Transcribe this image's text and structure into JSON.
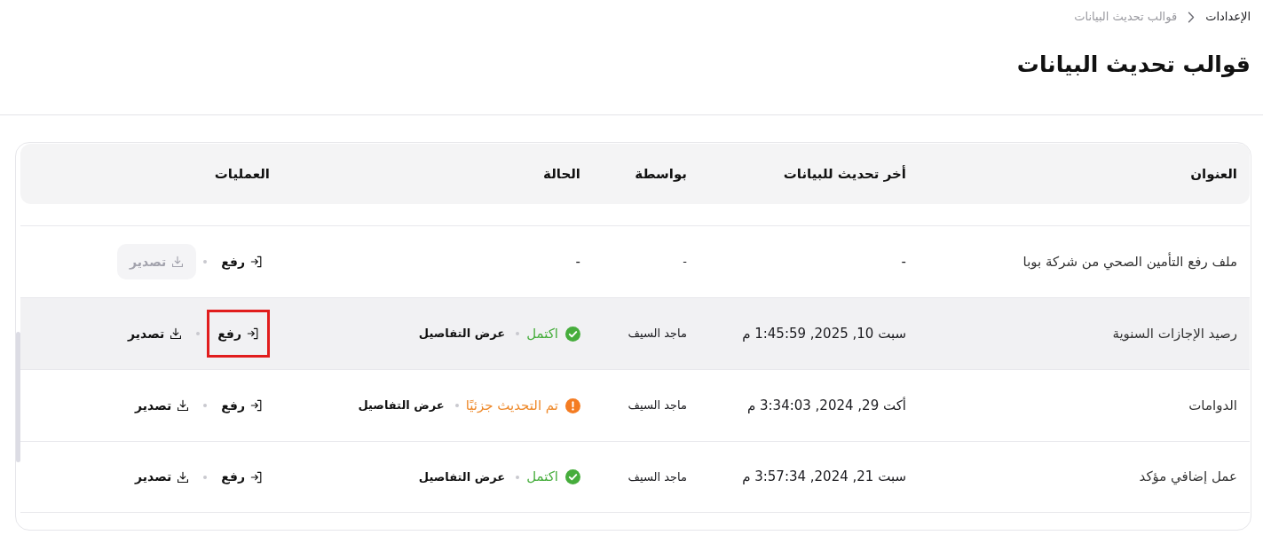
{
  "breadcrumb": [
    {
      "label": "الإعدادات",
      "current": false
    },
    {
      "label": "قوالب تحديث البيانات",
      "current": true
    }
  ],
  "page_title": "قوالب تحديث البيانات",
  "table": {
    "columns": [
      "العنوان",
      "أخر تحديث للبيانات",
      "بواسطة",
      "الحالة",
      "العمليات"
    ],
    "rows": [
      {
        "title": "ملف رفع التأمين الصحي من شركة بوبا",
        "last_update": "-",
        "by": "-",
        "hovered": false,
        "status": {
          "kind": "none",
          "label": "-"
        },
        "actions": [
          {
            "kind": "upload",
            "label": "رفع",
            "disabled": false,
            "highlighted": false
          },
          {
            "kind": "export",
            "label": "تصدير",
            "disabled": true,
            "highlighted": false
          }
        ]
      },
      {
        "title": "رصيد الإجازات السنوية",
        "last_update": "سبت 10, 2025, 1:45:59 م",
        "by": "ماجد السيف",
        "hovered": true,
        "status": {
          "kind": "complete",
          "label": "اكتمل",
          "details": "عرض التفاصيل"
        },
        "actions": [
          {
            "kind": "upload",
            "label": "رفع",
            "disabled": false,
            "highlighted": true
          },
          {
            "kind": "export",
            "label": "تصدير",
            "disabled": false,
            "highlighted": false
          }
        ]
      },
      {
        "title": "الدوامات",
        "last_update": "أكت 29, 2024, 3:34:03 م",
        "by": "ماجد السيف",
        "hovered": false,
        "status": {
          "kind": "partial",
          "label": "تم التحديث جزئيًا",
          "details": "عرض التفاصيل"
        },
        "actions": [
          {
            "kind": "upload",
            "label": "رفع",
            "disabled": false,
            "highlighted": false
          },
          {
            "kind": "export",
            "label": "تصدير",
            "disabled": false,
            "highlighted": false
          }
        ]
      },
      {
        "title": "عمل إضافي مؤكد",
        "last_update": "سبت 21, 2024, 3:57:34 م",
        "by": "ماجد السيف",
        "hovered": false,
        "status": {
          "kind": "complete",
          "label": "اكتمل",
          "details": "عرض التفاصيل"
        },
        "actions": [
          {
            "kind": "upload",
            "label": "رفع",
            "disabled": false,
            "highlighted": false
          },
          {
            "kind": "export",
            "label": "تصدير",
            "disabled": false,
            "highlighted": false
          }
        ]
      }
    ]
  }
}
